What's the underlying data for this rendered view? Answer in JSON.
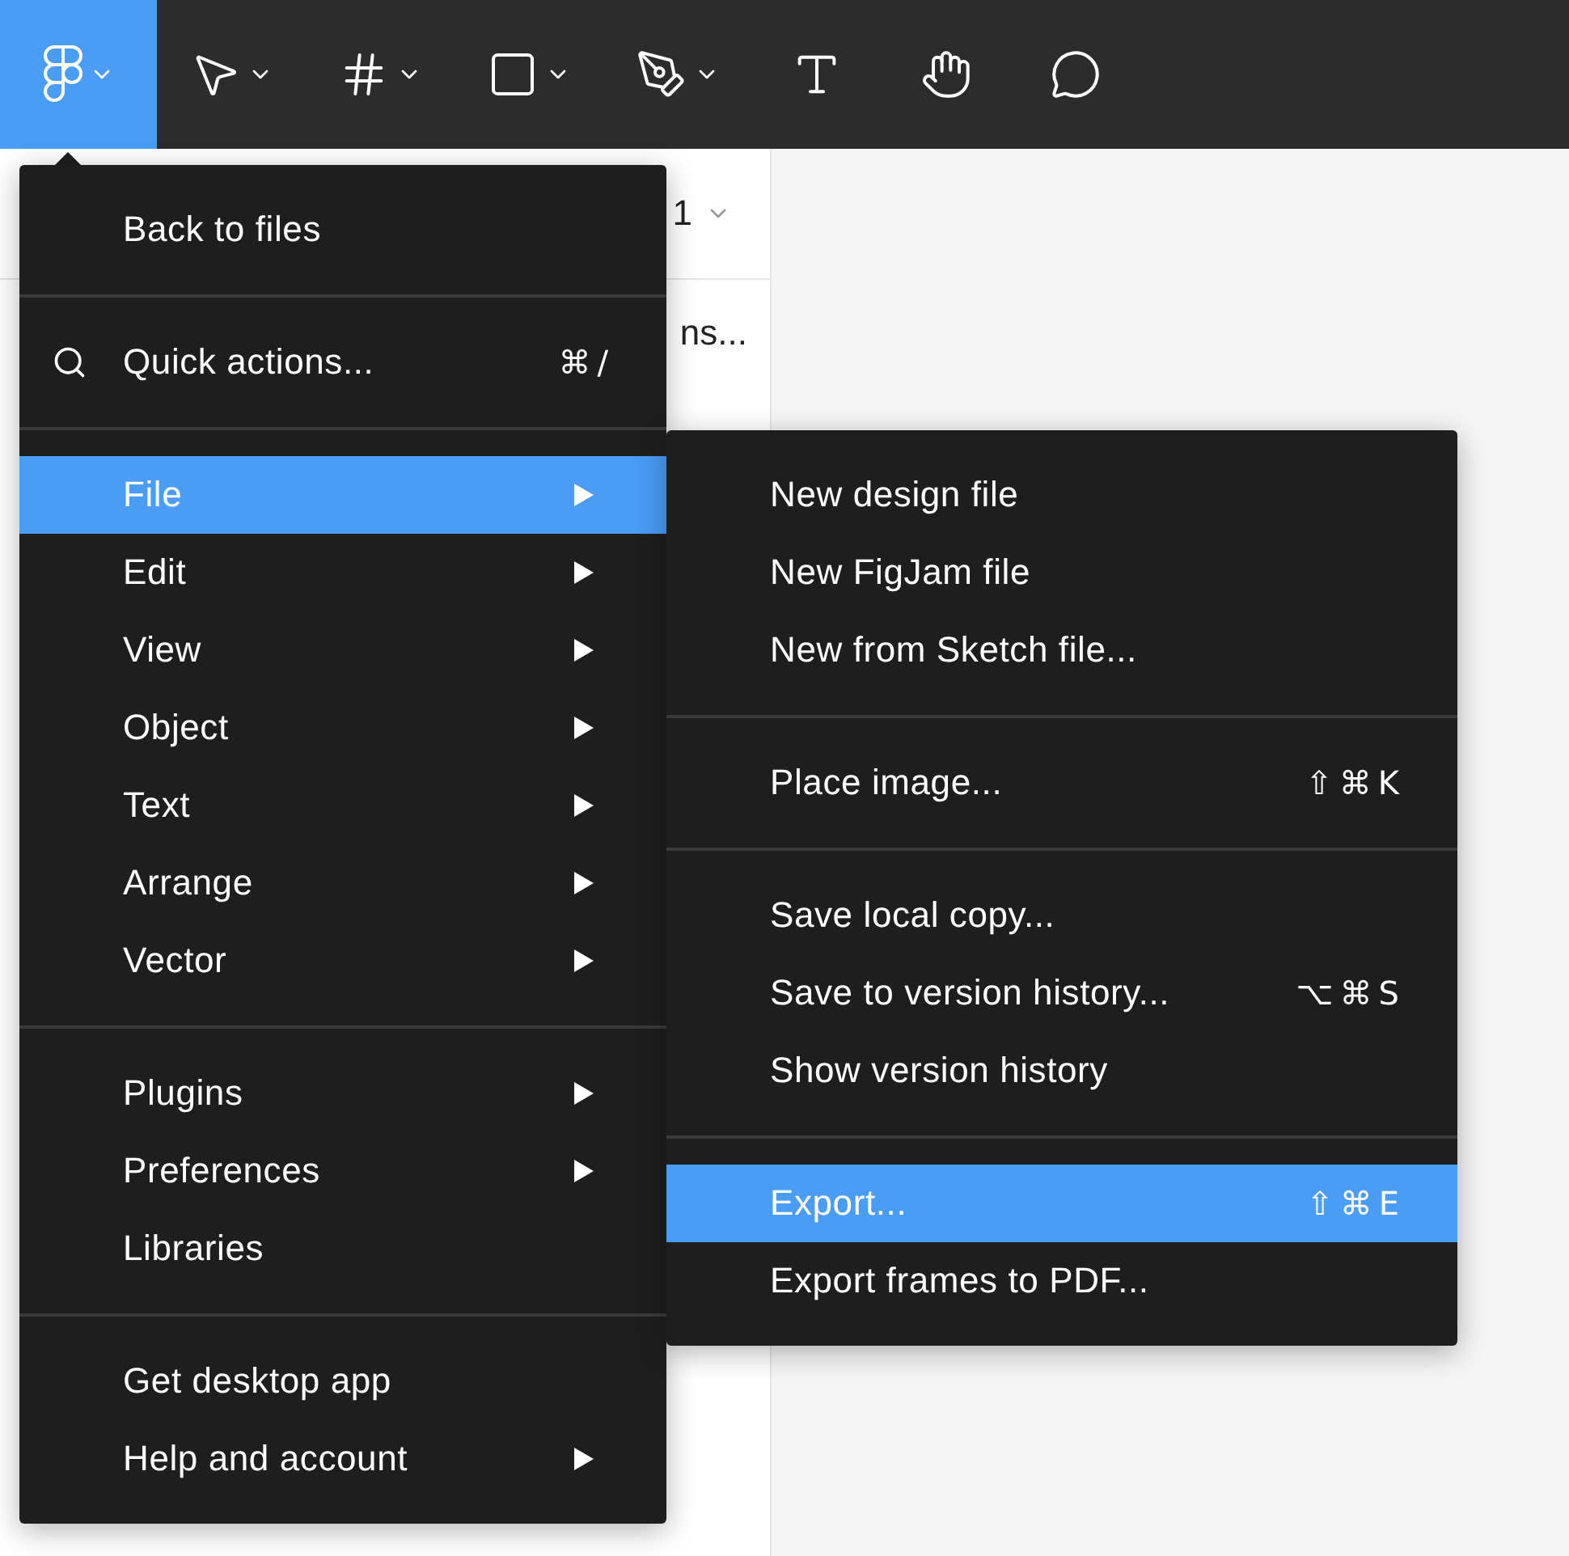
{
  "toolbar": {
    "tools": [
      {
        "kind": "logo",
        "dropdown": true,
        "selected": true
      },
      {
        "kind": "move",
        "dropdown": true,
        "selected": false
      },
      {
        "kind": "frame",
        "dropdown": true,
        "selected": false
      },
      {
        "kind": "shape",
        "dropdown": true,
        "selected": false
      },
      {
        "kind": "pen",
        "dropdown": true,
        "selected": false
      },
      {
        "kind": "text",
        "dropdown": false,
        "selected": false
      },
      {
        "kind": "hand",
        "dropdown": false,
        "selected": false
      },
      {
        "kind": "comment",
        "dropdown": false,
        "selected": false
      }
    ]
  },
  "layers_panel": {
    "page_label": "1",
    "layer_label": "ns..."
  },
  "main_menu": {
    "sections": [
      [
        {
          "label": "Back to files",
          "kind": "plain",
          "submenu": false,
          "selected": false
        }
      ],
      [
        {
          "label": "Quick actions...",
          "kind": "search",
          "shortcut": "⌘/",
          "submenu": false,
          "selected": false
        }
      ],
      [
        {
          "label": "File",
          "kind": "plain",
          "submenu": true,
          "selected": true
        },
        {
          "label": "Edit",
          "kind": "plain",
          "submenu": true,
          "selected": false
        },
        {
          "label": "View",
          "kind": "plain",
          "submenu": true,
          "selected": false
        },
        {
          "label": "Object",
          "kind": "plain",
          "submenu": true,
          "selected": false
        },
        {
          "label": "Text",
          "kind": "plain",
          "submenu": true,
          "selected": false
        },
        {
          "label": "Arrange",
          "kind": "plain",
          "submenu": true,
          "selected": false
        },
        {
          "label": "Vector",
          "kind": "plain",
          "submenu": true,
          "selected": false
        }
      ],
      [
        {
          "label": "Plugins",
          "kind": "plain",
          "submenu": true,
          "selected": false
        },
        {
          "label": "Preferences",
          "kind": "plain",
          "submenu": true,
          "selected": false
        },
        {
          "label": "Libraries",
          "kind": "plain",
          "submenu": false,
          "selected": false
        }
      ],
      [
        {
          "label": "Get desktop app",
          "kind": "plain",
          "submenu": false,
          "selected": false
        },
        {
          "label": "Help and account",
          "kind": "plain",
          "submenu": true,
          "selected": false
        }
      ]
    ]
  },
  "file_submenu": {
    "sections": [
      [
        {
          "label": "New design file",
          "selected": false
        },
        {
          "label": "New FigJam file",
          "selected": false
        },
        {
          "label": "New from Sketch file...",
          "selected": false
        }
      ],
      [
        {
          "label": "Place image...",
          "shortcut": "⇧⌘K",
          "selected": false
        }
      ],
      [
        {
          "label": "Save local copy...",
          "selected": false
        },
        {
          "label": "Save to version history...",
          "shortcut": "⌥⌘S",
          "selected": false
        },
        {
          "label": "Show version history",
          "selected": false
        }
      ],
      [
        {
          "label": "Export...",
          "shortcut": "⇧⌘E",
          "selected": true
        },
        {
          "label": "Export frames to PDF...",
          "selected": false
        }
      ]
    ]
  }
}
